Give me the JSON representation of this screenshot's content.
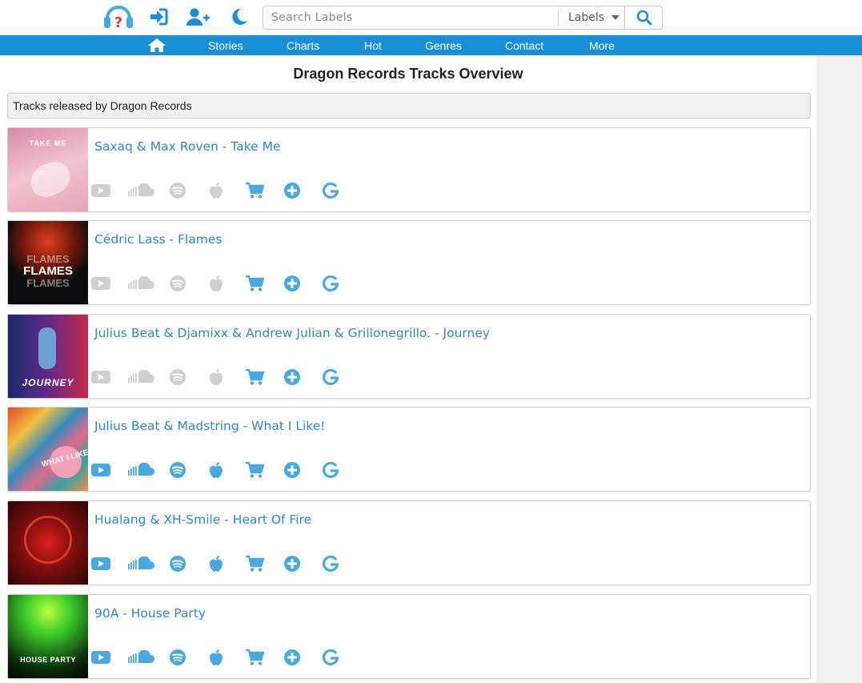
{
  "search": {
    "placeholder": "Search Labels",
    "category": "Labels"
  },
  "nav": {
    "items": [
      "Stories",
      "Charts",
      "Hot",
      "Genres",
      "Contact",
      "More"
    ]
  },
  "page": {
    "title": "Dragon Records Tracks Overview",
    "subtitle": "Tracks released by Dragon Records"
  },
  "colors": {
    "accent": "#1a8fd9",
    "link": "#2f86c8",
    "icon_active": "#4aa8e0",
    "icon_inactive": "#cfcfcf"
  },
  "tracks": [
    {
      "title": "Saxaq & Max Roven - Take Me",
      "cover_text": "TAKE ME",
      "streaming_available": false
    },
    {
      "title": "Cédric Lass - Flames",
      "cover_text": "FLAMES",
      "streaming_available": false
    },
    {
      "title": "Julius Beat & Djamixx & Andrew Julian & Grillonegrillo. - Journey",
      "cover_text": "JOURNEY",
      "streaming_available": false
    },
    {
      "title": "Julius Beat & Madstring - What I Like!",
      "cover_text": "WHAT I LIKE!",
      "streaming_available": true
    },
    {
      "title": "Hualang & XH-Smile - Heart Of Fire",
      "cover_text": "",
      "streaming_available": true
    },
    {
      "title": "90A - House Party",
      "cover_text": "HOUSE PARTY",
      "streaming_available": true
    }
  ],
  "track_actions": [
    "youtube-icon",
    "soundcloud-icon",
    "spotify-icon",
    "apple-icon",
    "cart-icon",
    "plus-circle-icon",
    "google-icon"
  ]
}
